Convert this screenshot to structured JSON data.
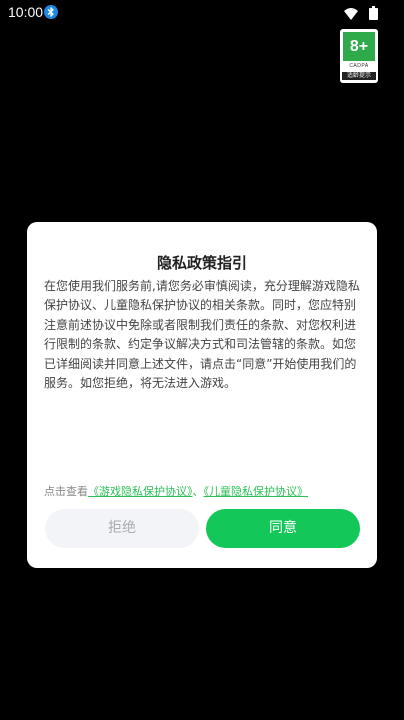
{
  "status_bar": {
    "time": "10:00"
  },
  "age_rating": {
    "rating": "8+",
    "org": "CADPA",
    "tip": "适龄提示"
  },
  "dialog": {
    "title": "隐私政策指引",
    "body": "在您使用我们服务前,请您务必审慎阅读，充分理解游戏隐私保护协议、儿童隐私保护协议的相关条款。同时，您应特别注意前述协议中免除或者限制我们责任的条款、对您权利进行限制的条款、约定争议解决方式和司法管辖的条款。如您已详细阅读并同意上述文件，请点击“同意”开始使用我们的服务。如您拒绝，将无法进入游戏。",
    "links_prefix": "点击查看",
    "link_game_privacy": "《游戏隐私保护协议》",
    "links_separator": "、",
    "link_child_privacy": "《儿童隐私保护协议》",
    "reject_label": "拒绝",
    "agree_label": "同意"
  },
  "colors": {
    "accent_green": "#14c759",
    "link_green": "#2bbf56",
    "background": "#000000"
  }
}
